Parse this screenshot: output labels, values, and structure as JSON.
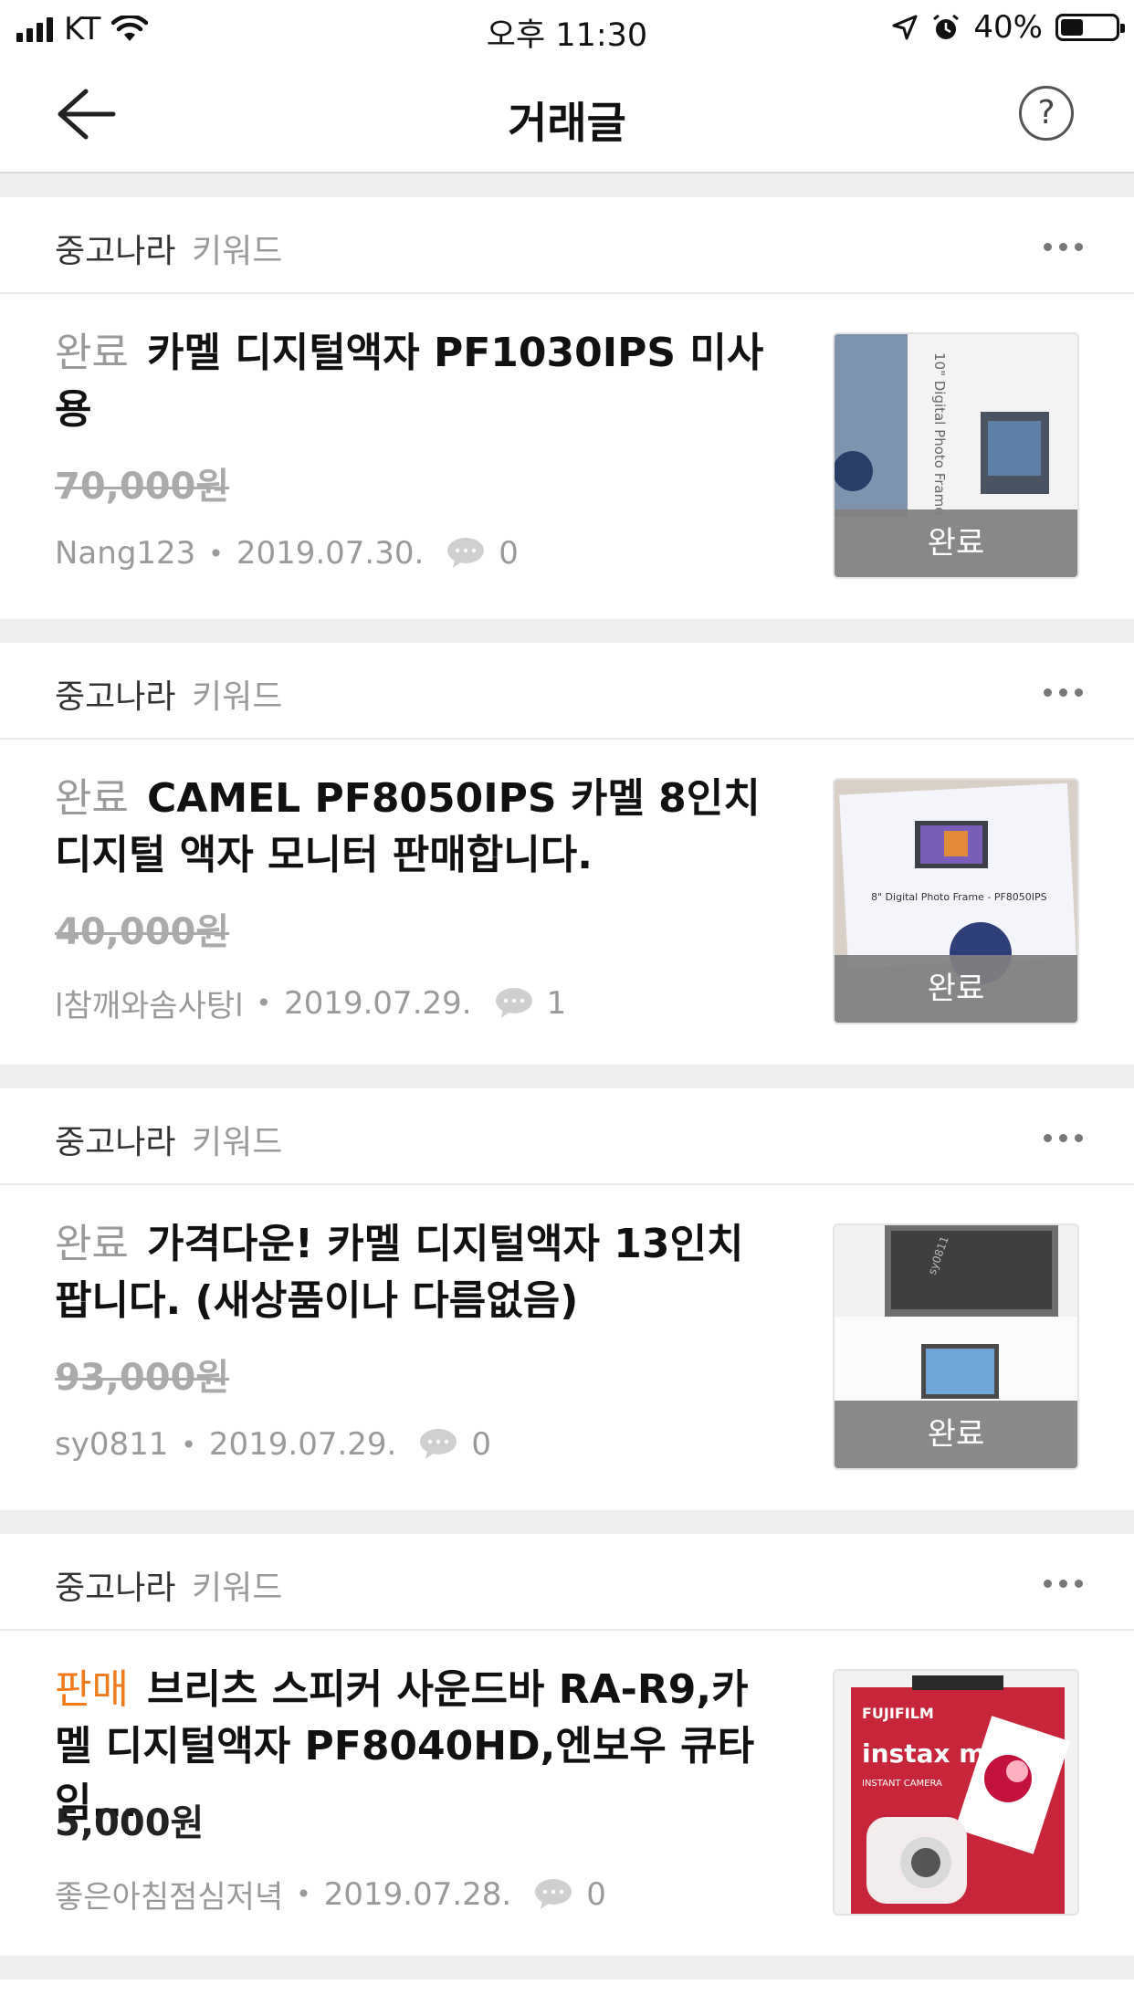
{
  "status_bar": {
    "carrier": "KT",
    "time": "오후 11:30",
    "battery": "40%"
  },
  "nav": {
    "title": "거래글",
    "help_glyph": "?"
  },
  "listings": [
    {
      "source": "중고나라",
      "keyword": "키워드",
      "status": "완료",
      "title": "카멜 디지털액자 PF1030IPS 미사용",
      "price": "70,000원",
      "seller": "Nang123",
      "date": "2019.07.30.",
      "comments": "0",
      "thumb_badge": "완료",
      "thumb_text": "10\" Digital Photo Frame"
    },
    {
      "source": "중고나라",
      "keyword": "키워드",
      "status": "완료",
      "title": "CAMEL PF8050IPS 카멜 8인치 디지털 액자 모니터 판매합니다.",
      "price": "40,000원",
      "seller": "l참깨와솜사탕l",
      "date": "2019.07.29.",
      "comments": "1",
      "thumb_badge": "완료",
      "thumb_text": "8\" Digital Photo Frame - PF8050IPS"
    },
    {
      "source": "중고나라",
      "keyword": "키워드",
      "status": "완료",
      "title": "가격다운! 카멜 디지털액자 13인치 팝니다. (새상품이나 다름없음)",
      "price": "93,000원",
      "seller": "sy0811",
      "date": "2019.07.29.",
      "comments": "0",
      "thumb_badge": "완료",
      "thumb_text": "sy0811"
    },
    {
      "source": "중고나라",
      "keyword": "키워드",
      "status": "판매",
      "title": "브리츠 스피커 사운드바 RA-R9,카멜 디지털액자 PF8040HD,엔보우 큐타임...",
      "price": "5,000원",
      "seller": "좋은아침점심저녁",
      "date": "2019.07.28.",
      "comments": "0",
      "thumb_brand": "FUJIFILM",
      "thumb_product": "instax mini7S",
      "thumb_sub": "INSTANT CAMERA"
    }
  ],
  "partial_next": {
    "source": "중고나라",
    "keyword": "키워드"
  },
  "colors": {
    "selling": "#f07b1c",
    "done": "#9a9a9a",
    "overlay": "#808080"
  }
}
